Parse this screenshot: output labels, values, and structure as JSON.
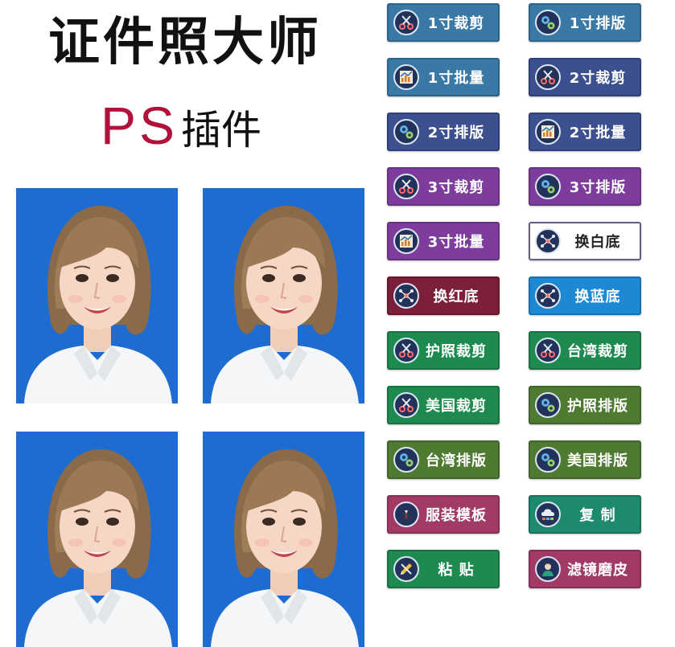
{
  "header": {
    "title": "证件照大师",
    "subtitle_ps": "PS",
    "subtitle_plugin": "插件"
  },
  "photos": {
    "count": 4,
    "background_color": "#1f6cd0"
  },
  "colors": {
    "steel_blue": "#3a78a6",
    "navy_purple": "#3c4f8e",
    "purple": "#7e3d9c",
    "maroon": "#7b1f3a",
    "sky_blue": "#1d89d4",
    "green": "#1f8a4f",
    "olive_green": "#4f7a32",
    "teal_green": "#1d8a6e",
    "rose": "#a23a68"
  },
  "buttons": [
    {
      "label": "1寸裁剪",
      "icon": "scissors-icon",
      "color": "#3a78a6"
    },
    {
      "label": "1寸排版",
      "icon": "gears-icon",
      "color": "#3a78a6"
    },
    {
      "label": "1寸批量",
      "icon": "chart-icon",
      "color": "#3a78a6"
    },
    {
      "label": "2寸裁剪",
      "icon": "scissors-icon",
      "color": "#3c4f8e"
    },
    {
      "label": "2寸排版",
      "icon": "gears-icon",
      "color": "#3c4f8e"
    },
    {
      "label": "2寸批量",
      "icon": "chart-icon",
      "color": "#3c4f8e"
    },
    {
      "label": "3寸裁剪",
      "icon": "scissors-icon",
      "color": "#7e3d9c"
    },
    {
      "label": "3寸排版",
      "icon": "gears-icon",
      "color": "#7e3d9c"
    },
    {
      "label": "3寸批量",
      "icon": "chart-icon",
      "color": "#7e3d9c"
    },
    {
      "label": "换白底",
      "icon": "network-icon",
      "color": "#ffffff"
    },
    {
      "label": "换红底",
      "icon": "network-icon",
      "color": "#7b1f3a"
    },
    {
      "label": "换蓝底",
      "icon": "network-icon",
      "color": "#1d89d4"
    },
    {
      "label": "护照裁剪",
      "icon": "scissors-icon",
      "color": "#1f8a4f"
    },
    {
      "label": "台湾裁剪",
      "icon": "scissors-icon",
      "color": "#1f8a4f"
    },
    {
      "label": "美国裁剪",
      "icon": "scissors-icon",
      "color": "#1f8a4f"
    },
    {
      "label": "护照排版",
      "icon": "gears-icon",
      "color": "#4f7a32"
    },
    {
      "label": "台湾排版",
      "icon": "gears-icon",
      "color": "#4f7a32"
    },
    {
      "label": "美国排版",
      "icon": "gears-icon",
      "color": "#4f7a32"
    },
    {
      "label": "服装模板",
      "icon": "suit-icon",
      "color": "#a23a68"
    },
    {
      "label": "复 制",
      "icon": "cloud-icon",
      "color": "#1d8a6e"
    },
    {
      "label": "粘 贴",
      "icon": "pencil-icon",
      "color": "#1f8a4f"
    },
    {
      "label": "滤镜磨皮",
      "icon": "person-icon",
      "color": "#a23a68"
    }
  ]
}
